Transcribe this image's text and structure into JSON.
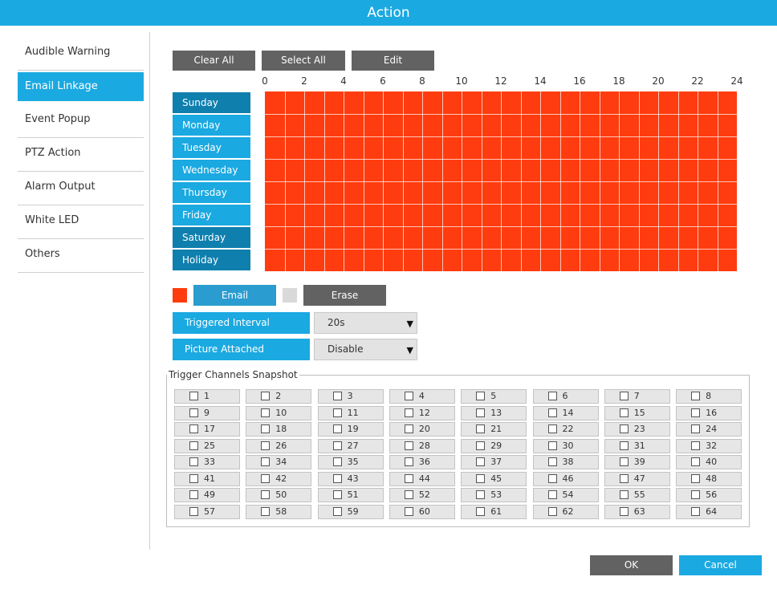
{
  "window": {
    "title": "Action"
  },
  "sidebar": {
    "items": [
      {
        "label": "Audible Warning",
        "active": false
      },
      {
        "label": "Email Linkage",
        "active": true
      },
      {
        "label": "Event Popup",
        "active": false
      },
      {
        "label": "PTZ Action",
        "active": false
      },
      {
        "label": "Alarm Output",
        "active": false
      },
      {
        "label": "White LED",
        "active": false
      },
      {
        "label": "Others",
        "active": false
      }
    ]
  },
  "toolbar": {
    "clear_all": "Clear All",
    "select_all": "Select All",
    "edit": "Edit"
  },
  "schedule": {
    "hour_labels": [
      "0",
      "2",
      "4",
      "6",
      "8",
      "10",
      "12",
      "14",
      "16",
      "18",
      "20",
      "22",
      "24"
    ],
    "days": [
      "Sunday",
      "Monday",
      "Tuesday",
      "Wednesday",
      "Thursday",
      "Friday",
      "Saturday",
      "Holiday"
    ],
    "hours_per_day": 24,
    "all_hours_selected": true,
    "fill_color": "#ff3c0f"
  },
  "mode": {
    "email_label": "Email",
    "erase_label": "Erase",
    "email_color": "#ff3c0f",
    "erase_color": "#d9d9d9"
  },
  "triggered_interval": {
    "label": "Triggered Interval",
    "value": "20s"
  },
  "picture_attached": {
    "label": "Picture Attached",
    "value": "Disable"
  },
  "snapshot": {
    "legend": "Trigger Channels Snapshot",
    "channels": [
      "1",
      "2",
      "3",
      "4",
      "5",
      "6",
      "7",
      "8",
      "9",
      "10",
      "11",
      "12",
      "13",
      "14",
      "15",
      "16",
      "17",
      "18",
      "19",
      "20",
      "21",
      "22",
      "23",
      "24",
      "25",
      "26",
      "27",
      "28",
      "29",
      "30",
      "31",
      "32",
      "33",
      "34",
      "35",
      "36",
      "37",
      "38",
      "39",
      "40",
      "41",
      "42",
      "43",
      "44",
      "45",
      "46",
      "47",
      "48",
      "49",
      "50",
      "51",
      "52",
      "53",
      "54",
      "55",
      "56",
      "57",
      "58",
      "59",
      "60",
      "61",
      "62",
      "63",
      "64"
    ]
  },
  "footer": {
    "ok": "OK",
    "cancel": "Cancel"
  },
  "colors": {
    "accent": "#1ba9e1",
    "day_dark": "#0f7fae",
    "button_dark": "#626262"
  }
}
